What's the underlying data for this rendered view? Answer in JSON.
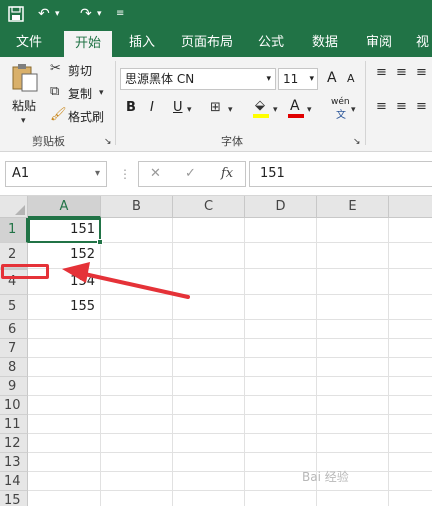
{
  "quick_access": {
    "undo_icon": "↶",
    "redo_icon": "↷"
  },
  "tabs": [
    {
      "label": "文件",
      "active": false
    },
    {
      "label": "开始",
      "active": true
    },
    {
      "label": "插入",
      "active": false
    },
    {
      "label": "页面布局",
      "active": false
    },
    {
      "label": "公式",
      "active": false
    },
    {
      "label": "数据",
      "active": false
    },
    {
      "label": "审阅",
      "active": false
    },
    {
      "label": "视",
      "active": false
    }
  ],
  "ribbon": {
    "clipboard": {
      "paste_label": "粘贴",
      "cut_label": "剪切",
      "copy_label": "复制",
      "format_painter_label": "格式刷",
      "group_label": "剪贴板"
    },
    "font": {
      "font_name": "思源黑体 CN",
      "font_size": "11",
      "grow_label": "A",
      "shrink_label": "A",
      "bold": "B",
      "italic": "I",
      "underline": "U",
      "font_color_label": "A",
      "phonetic_label": "wén",
      "group_label": "字体"
    }
  },
  "formula_bar": {
    "name_box": "A1",
    "fx_label": "fx",
    "cancel_icon": "✕",
    "enter_icon": "✓",
    "value": "151"
  },
  "grid": {
    "columns": [
      "A",
      "B",
      "C",
      "D",
      "E"
    ],
    "rows": [
      "1",
      "2",
      "4",
      "5",
      "6",
      "7",
      "8",
      "9",
      "10",
      "11",
      "12",
      "13",
      "14",
      "15"
    ],
    "values": [
      "151",
      "152",
      "154",
      "155"
    ]
  },
  "watermark": "Bai 经验",
  "colors": {
    "accent": "#217346",
    "annotation": "#e53238"
  }
}
